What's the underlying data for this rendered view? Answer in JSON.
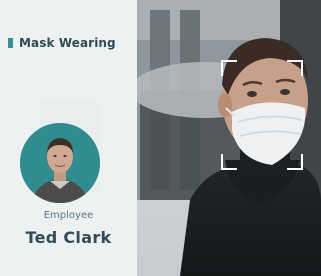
{
  "panel": {
    "title": "Mask Wearing",
    "role_label": "Employee",
    "person_name": "Ted Clark"
  },
  "colors": {
    "accent": "#3a8f93",
    "title_text": "#2f4a57",
    "name_text": "#314b58",
    "frame": "#ffffff"
  },
  "icons": {
    "title_marker": "status-bar-icon",
    "detection_frame": "face-detection-frame-icon"
  }
}
